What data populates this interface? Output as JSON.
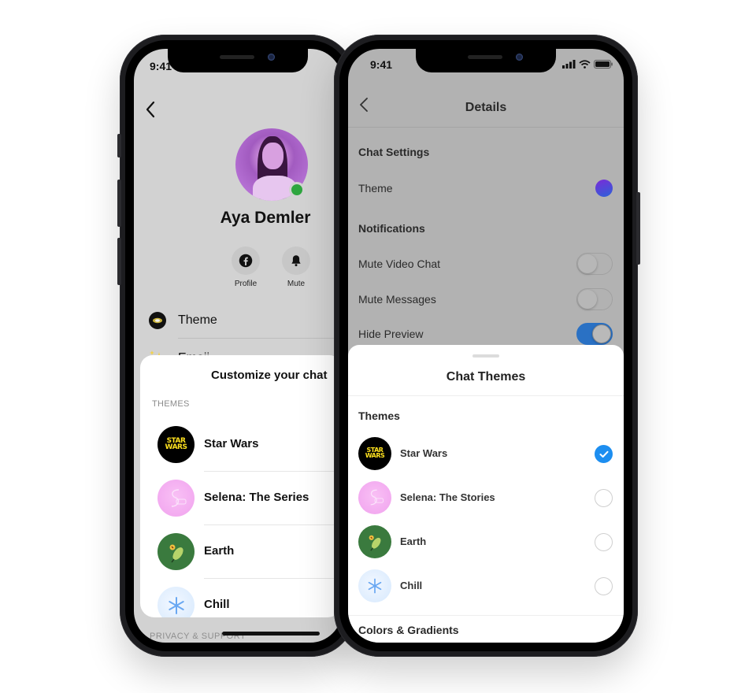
{
  "left_phone": {
    "status_time": "9:41",
    "profile": {
      "name": "Aya Demler",
      "online": true,
      "actions": [
        {
          "icon": "facebook-icon",
          "label": "Profile"
        },
        {
          "icon": "bell-icon",
          "label": "Mute"
        }
      ]
    },
    "menu": [
      {
        "icon": "theme-icon",
        "label": "Theme"
      },
      {
        "icon": "sparkles-icon",
        "label": "Emoji"
      }
    ],
    "sheet": {
      "title": "Customize your chat",
      "section_label": "THEMES",
      "themes": [
        {
          "name": "Star Wars",
          "icon": "star-wars-icon"
        },
        {
          "name": "Selena: The Series",
          "icon": "selena-icon"
        },
        {
          "name": "Earth",
          "icon": "earth-icon"
        },
        {
          "name": "Chill",
          "icon": "snowflake-icon"
        }
      ]
    },
    "below_sheet_label": "PRIVACY & SUPPORT",
    "sw_logo": "STAR WARS"
  },
  "right_phone": {
    "status_time": "9:41",
    "nav": {
      "title": "Details"
    },
    "chat_settings": {
      "title": "Chat Settings",
      "theme_label": "Theme",
      "theme_color": "#5a3fd8"
    },
    "notifications": {
      "title": "Notifications",
      "toggles": [
        {
          "label": "Mute Video Chat",
          "on": false
        },
        {
          "label": "Mute Messages",
          "on": false
        },
        {
          "label": "Hide Preview",
          "on": true
        }
      ]
    },
    "sheet": {
      "title": "Chat Themes",
      "section_themes": "Themes",
      "themes": [
        {
          "name": "Star Wars",
          "selected": true
        },
        {
          "name": "Selena: The Stories",
          "selected": false
        },
        {
          "name": "Earth",
          "selected": false
        },
        {
          "name": "Chill",
          "selected": false
        }
      ],
      "section_colors": "Colors & Gradients"
    }
  },
  "colors": {
    "accent_blue": "#1d8ef0",
    "toggle_on": "#2a71c4",
    "online_green": "#2ea63f"
  }
}
